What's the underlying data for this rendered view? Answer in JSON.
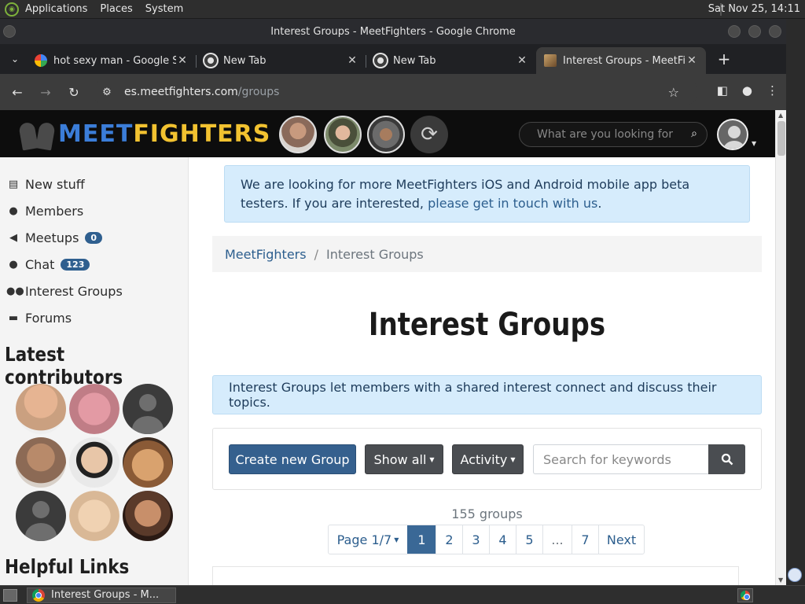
{
  "system_panel": {
    "menus": [
      "Applications",
      "Places",
      "System"
    ],
    "clock": "Sat Nov 25, 14:11"
  },
  "window": {
    "title": "Interest Groups - MeetFighters - Google Chrome"
  },
  "tabs": [
    {
      "title": "hot sexy man - Google Se",
      "favicon": "google-icon"
    },
    {
      "title": "New Tab",
      "favicon": "chrome-icon"
    },
    {
      "title": "New Tab",
      "favicon": "chrome-icon"
    },
    {
      "title": "Interest Groups - MeetFig",
      "favicon": "meetfighters-icon",
      "active": true
    }
  ],
  "address_bar": {
    "host": "es.meetfighters.com",
    "path": "/groups"
  },
  "site_header": {
    "brand_blue": "MEET",
    "brand_gold": "FIGHTERS",
    "search_placeholder": "What are you looking for"
  },
  "sidebar": {
    "items": [
      {
        "label": "New stuff",
        "icon": "newspaper-icon"
      },
      {
        "label": "Members",
        "icon": "user-icon"
      },
      {
        "label": "Meetups",
        "icon": "megaphone-icon",
        "badge": "0"
      },
      {
        "label": "Chat",
        "icon": "chat-icon",
        "badge": "123"
      },
      {
        "label": "Interest Groups",
        "icon": "users-icon"
      },
      {
        "label": "Forums",
        "icon": "forum-icon"
      }
    ],
    "latest_contributors_heading": "Latest contributors",
    "helpful_links_heading": "Helpful Links"
  },
  "beta_alert": {
    "text_1": "We are looking for more ",
    "text_2": "MeetFighters iOS and Android mobile app",
    "text_3": " beta testers. If you are interested, ",
    "link": "please get in touch with us",
    "text_4": "."
  },
  "breadcrumb": {
    "home": "MeetFighters",
    "separator": "/",
    "current": "Interest Groups"
  },
  "page_title": "Interest Groups",
  "info_text": "Interest Groups let members with a shared interest connect and discuss their topics.",
  "toolbar": {
    "create_label": "Create new Group",
    "show_label": "Show all",
    "sort_label": "Activity",
    "search_placeholder": "Search for keywords"
  },
  "group_count": "155 groups",
  "pagination": {
    "page_label": "Page 1/7",
    "pages": [
      "1",
      "2",
      "3",
      "4",
      "5",
      "...",
      "7"
    ],
    "current": "1",
    "next": "Next"
  },
  "taskbar": {
    "task_label": "Interest Groups - M..."
  },
  "colors": {
    "brand_blue": "#3b7dd8",
    "brand_gold": "#f2c230",
    "primary_button": "#35608e",
    "alert_bg": "#d6ecfc"
  }
}
